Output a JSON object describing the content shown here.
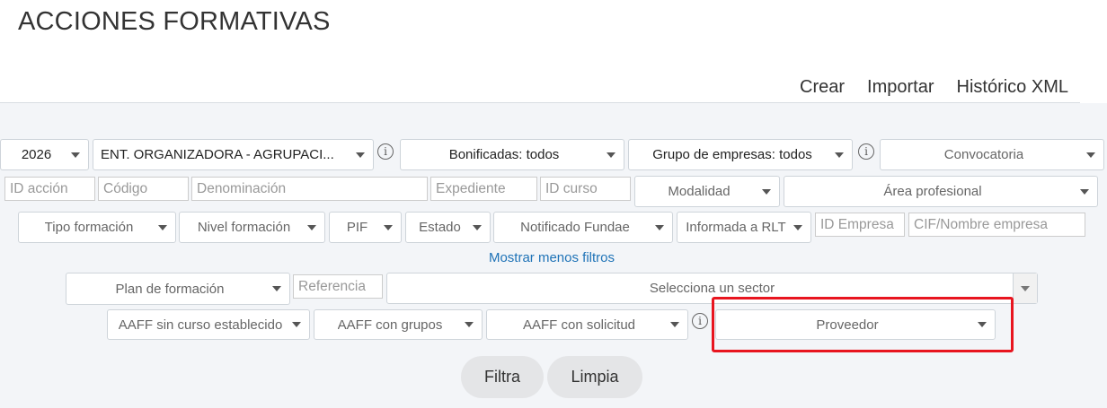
{
  "page": {
    "title": "ACCIONES FORMATIVAS"
  },
  "nav": {
    "crear": "Crear",
    "importar": "Importar",
    "historico": "Histórico XML"
  },
  "filters": {
    "year": "2026",
    "entidad": "ENT. ORGANIZADORA - AGRUPACI...",
    "bonificadas": "Bonificadas: todos",
    "grupo_empresas": "Grupo de empresas: todos",
    "convocatoria": "Convocatoria",
    "id_accion": "ID acción",
    "codigo": "Código",
    "denominacion": "Denominación",
    "expediente": "Expediente",
    "id_curso": "ID curso",
    "modalidad": "Modalidad",
    "area_profesional": "Área profesional",
    "tipo_formacion": "Tipo formación",
    "nivel_formacion": "Nivel formación",
    "pif": "PIF",
    "estado": "Estado",
    "notificado_fundae": "Notificado Fundae",
    "informada_rlt": "Informada a RLT",
    "id_empresa": "ID Empresa",
    "cif_nombre": "CIF/Nombre empresa",
    "mostrar_menos": "Mostrar menos filtros",
    "plan_formacion": "Plan de formación",
    "referencia": "Referencia",
    "sector": "Selecciona un sector",
    "aaff_sin_curso": "AAFF sin curso establecido",
    "aaff_con_grupos": "AAFF con grupos",
    "aaff_con_solicitud": "AAFF con solicitud",
    "proveedor": "Proveedor"
  },
  "actions": {
    "filtra": "Filtra",
    "limpia": "Limpia"
  },
  "icons": {
    "info": "i"
  },
  "colors": {
    "link": "#1f73b7",
    "highlight": "#e8151f",
    "panel": "#f3f5f8"
  }
}
